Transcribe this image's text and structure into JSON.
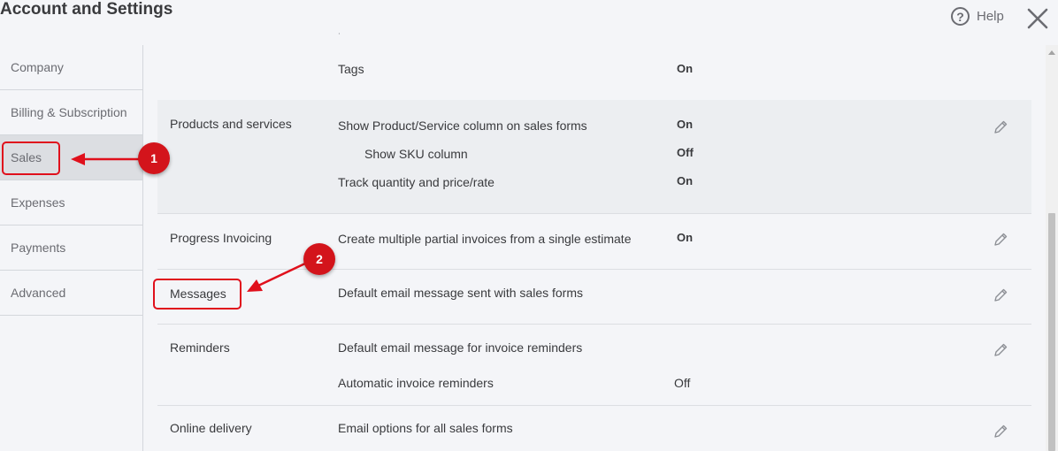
{
  "header": {
    "title": "Account and Settings",
    "help_label": "Help",
    "help_glyph": "?",
    "help_icon": "help-circle-icon",
    "close_icon": "close-icon"
  },
  "sidebar": {
    "items": [
      {
        "label": "Company"
      },
      {
        "label": "Billing & Subscription"
      },
      {
        "label": "Sales",
        "active": true
      },
      {
        "label": "Expenses"
      },
      {
        "label": "Payments"
      },
      {
        "label": "Advanced"
      }
    ]
  },
  "sections": {
    "tags_row": {
      "label": "Tags",
      "value": "On"
    },
    "products": {
      "title": "Products and services",
      "rows": [
        {
          "label": "Show Product/Service column on sales forms",
          "value": "On"
        },
        {
          "label": "Show SKU column",
          "value": "Off"
        },
        {
          "label": "Track quantity and price/rate",
          "value": "On"
        }
      ]
    },
    "progress": {
      "title": "Progress Invoicing",
      "rows": [
        {
          "label": "Create multiple partial invoices from a single estimate",
          "value": "On"
        }
      ]
    },
    "messages": {
      "title": "Messages",
      "rows": [
        {
          "label": "Default email message sent with sales forms"
        }
      ]
    },
    "reminders": {
      "title": "Reminders",
      "rows": [
        {
          "label": "Default email message for invoice reminders"
        },
        {
          "label": "Automatic invoice reminders",
          "value": "Off"
        }
      ]
    },
    "delivery": {
      "title": "Online delivery",
      "rows": [
        {
          "label": "Email options for all sales forms"
        }
      ]
    }
  },
  "annotations": {
    "badge1": "1",
    "badge2": "2",
    "color": "#d3141b"
  }
}
